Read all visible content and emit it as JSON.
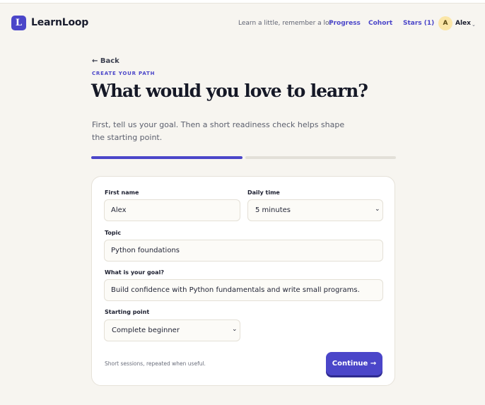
{
  "brand": {
    "logo_letter": "L",
    "name": "LearnLoop"
  },
  "header": {
    "tagline": "Learn a little, remember a lot",
    "nav": {
      "progress": "Progress",
      "cohort": "Cohort",
      "stars": "Stars (1)"
    },
    "user": {
      "initial": "A",
      "name": "Alex",
      "caret": "⌄"
    }
  },
  "intro": {
    "back": "← Back",
    "eyebrow": "CREATE YOUR PATH",
    "title": "What would you love to learn?",
    "lead": "First, tell us your goal. Then a short readiness check helps shape the starting point."
  },
  "progress": {
    "current_step": 1,
    "total_steps": 2
  },
  "form": {
    "first_name": {
      "label": "First name",
      "value": "Alex"
    },
    "daily_time": {
      "label": "Daily time",
      "value": "5 minutes"
    },
    "topic": {
      "label": "Topic",
      "value": "Python foundations"
    },
    "goal": {
      "label": "What is your goal?",
      "value": "Build confidence with Python fundamentals and write small programs."
    },
    "starting_point": {
      "label": "Starting point",
      "value": "Complete beginner"
    },
    "helper": "Short sessions, repeated when useful.",
    "continue": "Continue →"
  },
  "colors": {
    "accent": "#4b46c9",
    "background": "#f7f5f0",
    "avatar": "#fbe6a7"
  }
}
